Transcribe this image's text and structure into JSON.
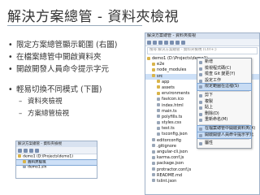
{
  "slide": {
    "title": "解決方案總管 - 資料夾檢視",
    "bullets": [
      "限定方案總管顯示範圍 (右圖)",
      "在檔案總管中開啟資料夾",
      "開啟開發人員命令提示字元"
    ],
    "bullet2": "輕易切換不同模式 (下圖)",
    "sub_bullets": [
      "資料夾檢視",
      "方案總管檢視"
    ]
  },
  "explorer": {
    "title": "解決方案總管 - 資料夾檢視",
    "search_placeholder": "搜尋 解決方案總管 - 資料夾檢視 (Ctrl+;)",
    "items": [
      "demo1 (D:\\Projects\\demo1)",
      "e2e",
      "node_modules",
      "src",
      "app",
      "assets",
      "environments",
      "favicon.ico",
      "index.html",
      "main.ts",
      "polyfills.ts",
      "styles.css",
      "test.ts",
      "tsconfig.json",
      "editorconfig",
      ".gitignore",
      "angular-cli.json",
      "karma.conf.js",
      "package.json",
      "protractor.conf.js",
      "README.md",
      "tslint.json"
    ]
  },
  "context_menu": {
    "items": [
      "新增",
      "檢視程式碼(C)",
      "檢查 Git 變更(Y)",
      "設定工作",
      "限定範圍在這裡(S)",
      "剪下",
      "複製",
      "貼上",
      "刪除(D)",
      "重新命名(M)",
      "在檔案總管中開啟資料夾(X)",
      "開啟開發人員命令提示字元",
      "屬性"
    ]
  },
  "explorer_small": {
    "title": "解決方案總管 - 資料夾檢視",
    "items": [
      "demo1 (D:\\Projects\\demo1)",
      "資料夾檢視",
      "demo1.sln"
    ]
  }
}
